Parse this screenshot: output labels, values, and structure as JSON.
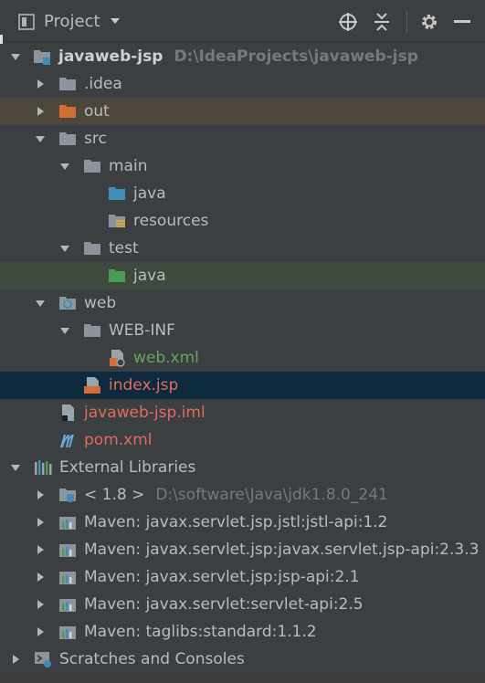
{
  "toolbar": {
    "title": "Project",
    "icons": [
      "project-view-icon",
      "chevron-down-icon",
      "locate-icon",
      "collapse-all-icon",
      "gear-icon",
      "hide-icon"
    ]
  },
  "tree": {
    "root": {
      "label": "javaweb-jsp",
      "path": "D:\\IdeaProjects\\javaweb-jsp"
    },
    "idea": "idea",
    "idea_dot": ".idea",
    "out": "out",
    "src": "src",
    "main": "main",
    "main_java": "java",
    "resources": "resources",
    "test": "test",
    "test_java": "java",
    "web": "web",
    "webinf": "WEB-INF",
    "webxml": "web.xml",
    "indexjsp": "index.jsp",
    "iml": "javaweb-jsp.iml",
    "pom": "pom.xml",
    "external_libraries": "External Libraries",
    "jdk": {
      "label": "< 1.8 >",
      "path": "D:\\software\\Java\\jdk1.8.0_241"
    },
    "libs": [
      "Maven: javax.servlet.jsp.jstl:jstl-api:1.2",
      "Maven: javax.servlet.jsp:javax.servlet.jsp-api:2.3.3",
      "Maven: javax.servlet.jsp:jsp-api:2.1",
      "Maven: javax.servlet:servlet-api:2.5",
      "Maven: taglibs:standard:1.1.2"
    ],
    "scratches": "Scratches and Consoles"
  },
  "colors": {
    "background": "#3c3f41",
    "selected_out": "#4d473b",
    "selected_test_java": "#3f4a3e",
    "selected_index": "#0d293e",
    "folder_grey": "#8c959e",
    "folder_blue": "#3d8fb6",
    "folder_green": "#499c54",
    "folder_orange": "#d36d32",
    "red_text": "#e06c5c",
    "green_text": "#62a85a"
  }
}
